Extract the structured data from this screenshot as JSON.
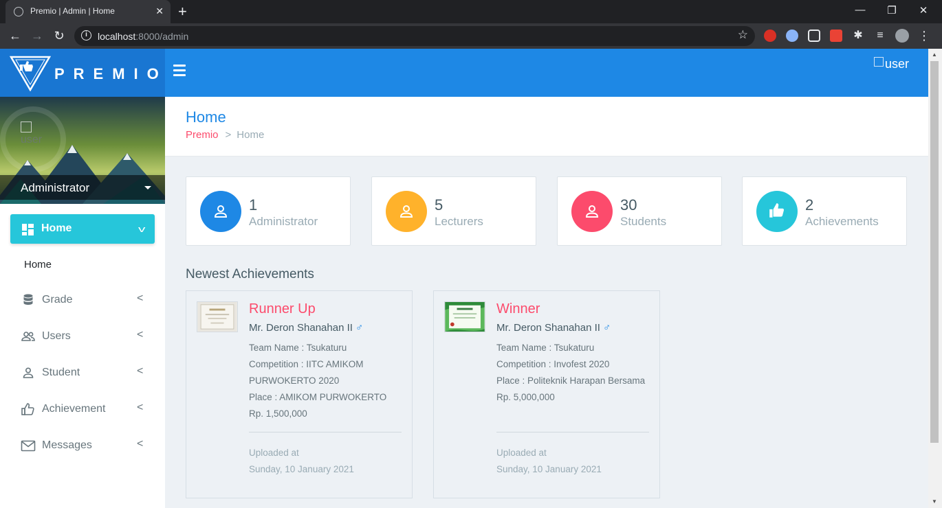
{
  "browser": {
    "tab_title": "Premio | Admin | Home",
    "tab_close": "✕",
    "new_tab": "+",
    "url_host": "localhost",
    "url_rest": ":8000/admin",
    "win_min": "—",
    "win_restore": "❐",
    "win_close": "✕"
  },
  "header": {
    "logo_text": "PREMIO",
    "user_img_alt": "user"
  },
  "sidebar": {
    "profile_img_alt": "user",
    "profile_name": "Administrator",
    "active_menu": {
      "label": "Home",
      "icon": "dashboard-icon"
    },
    "active_submenu": "Home",
    "items": [
      {
        "label": "Grade",
        "icon": "database-icon"
      },
      {
        "label": "Users",
        "icon": "users-icon"
      },
      {
        "label": "Student",
        "icon": "user-icon"
      },
      {
        "label": "Achievement",
        "icon": "thumbs-up-icon"
      },
      {
        "label": "Messages",
        "icon": "envelope-icon"
      }
    ]
  },
  "page": {
    "title": "Home",
    "breadcrumb": {
      "root": "Premio",
      "current": "Home"
    }
  },
  "stats": [
    {
      "value": "1",
      "label": "Administrator",
      "color": "#1e88e5",
      "icon": "user-icon"
    },
    {
      "value": "5",
      "label": "Lecturers",
      "color": "#ffb22b",
      "icon": "user-icon"
    },
    {
      "value": "30",
      "label": "Students",
      "color": "#fc4b6c",
      "icon": "user-icon"
    },
    {
      "value": "2",
      "label": "Achievements",
      "color": "#26c6da",
      "icon": "thumbs-up-icon"
    }
  ],
  "achievements_section": {
    "title": "Newest Achievements",
    "items": [
      {
        "title": "Runner Up",
        "student": "Mr. Deron Shanahan II",
        "gender_symbol": "♂",
        "team": "Team Name : Tsukaturu",
        "competition": "Competition : IITC AMIKOM PURWOKERTO 2020",
        "place": "Place : AMIKOM PURWOKERTO",
        "prize": "Rp. 1,500,000",
        "uploaded_label": "Uploaded at",
        "uploaded_date": "Sunday, 10 January 2021"
      },
      {
        "title": "Winner",
        "student": "Mr. Deron Shanahan II",
        "gender_symbol": "♂",
        "team": "Team Name : Tsukaturu",
        "competition": "Competition : Invofest 2020",
        "place": "Place : Politeknik Harapan Bersama",
        "prize": "Rp. 5,000,000",
        "uploaded_label": "Uploaded at",
        "uploaded_date": "Sunday, 10 January 2021"
      }
    ]
  },
  "colors": {
    "primary": "#1e88e5",
    "info": "#26c6da",
    "danger": "#fc4b6c",
    "warning": "#ffb22b"
  }
}
